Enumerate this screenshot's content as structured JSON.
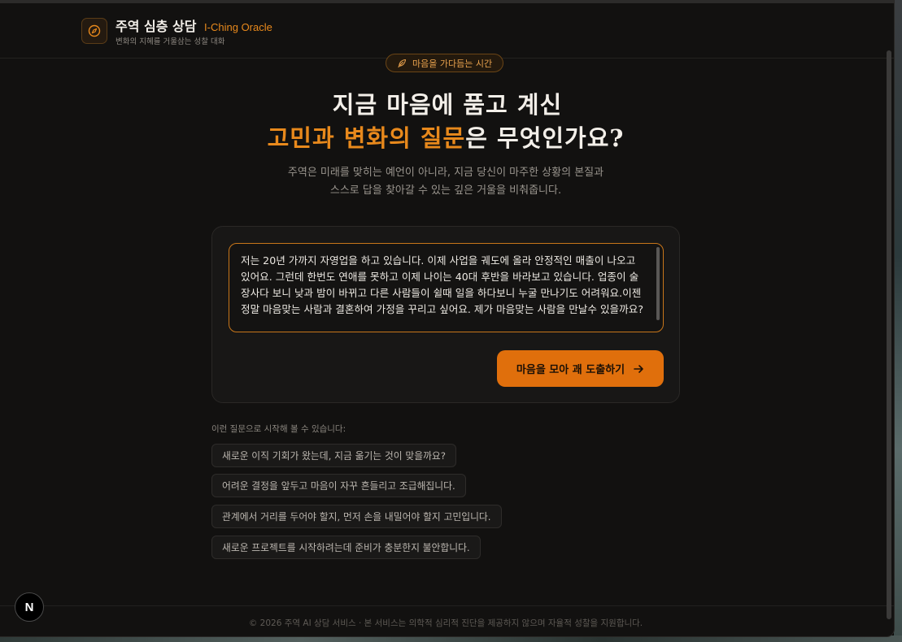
{
  "header": {
    "title": "주역 심층 상담",
    "subtitle": "I-Ching Oracle",
    "tagline": "변화의 지혜를 거울삼는 성찰 대화",
    "logo_icon": "compass-icon"
  },
  "hero": {
    "badge": "마음을 가다듬는 시간",
    "badge_icon": "feather-icon",
    "headline_line1": "지금 마음에 품고 계신",
    "headline_line2_accent": "고민과 변화의 질문",
    "headline_line2_rest": "은 무엇인가요?",
    "lead_line1": "주역은 미래를 맞히는 예언이 아니라, 지금 당신이 마주한 상황의 본질과",
    "lead_line2": "스스로 답을 찾아갈 수 있는 깊은 거울을 비춰줍니다."
  },
  "question": {
    "value": "저는 20년 가까지 자영업을 하고 있습니다. 이제 사업을 궤도에 올라 안정적인 매출이 나오고 있어요. 그런데 한번도 연애를 못하고 이제 나이는 40대 후반을 바라보고 있습니다. 업종이 술장사다 보니 낮과 밤이 바뀌고 다른 사람들이 쉴때 일을 하다보니 누굴 만나기도 어려워요.이젠 정말 마음맞는 사람과 결혼하여 가정을 꾸리고 싶어요. 제가 마음맞는 사람을 만날수 있을까요?",
    "submit_label": "마음을 모아 괘 도출하기",
    "submit_icon": "arrow-right-icon"
  },
  "suggestions": {
    "label": "이런 질문으로 시작해 볼 수 있습니다:",
    "items": [
      "새로운 이직 기회가 왔는데, 지금 옮기는 것이 맞을까요?",
      "어려운 결정을 앞두고 마음이 자꾸 흔들리고 조급해집니다.",
      "관계에서 거리를 두어야 할지, 먼저 손을 내밀어야 할지 고민입니다.",
      "새로운 프로젝트를 시작하려는데 준비가 충분한지 불안합니다."
    ]
  },
  "footer": {
    "text": "© 2026 주역 AI 상담 서비스 · 본 서비스는 의학적 심리적 진단을 제공하지 않으며 자율적 성찰을 지원합니다."
  },
  "dev_badge": "N",
  "colors": {
    "accent": "#e8891c",
    "button": "#e06f0c",
    "background": "#121110"
  }
}
